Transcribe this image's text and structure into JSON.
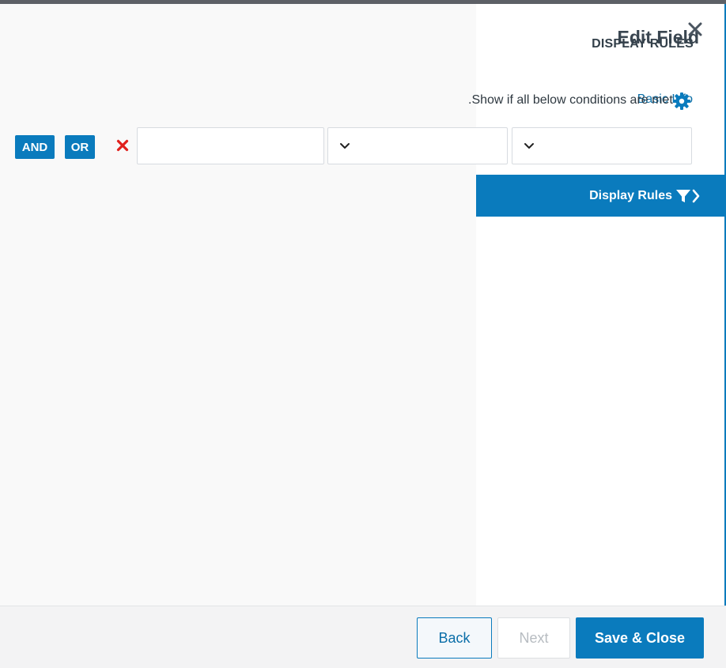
{
  "header": {
    "title": "Edit Field",
    "section_caption": "DISPLAY RULES",
    "basic_info_link": "Basic Info"
  },
  "rules": {
    "description": ".Show if all below conditions are met",
    "and_label": "AND",
    "or_label": "OR",
    "condition_row": {
      "text_value": "",
      "select_1_value": "",
      "select_2_value": ""
    }
  },
  "tabs": {
    "display_rules_label": "Display Rules"
  },
  "footer": {
    "back_label": "Back",
    "next_label": "Next",
    "save_close_label": "Save & Close"
  },
  "colors": {
    "primary": "#0a7bbd",
    "remove_red": "#e0201c",
    "left_panel_bg": "#f9f9f9",
    "footer_bg": "#f3f3f4"
  },
  "icons": {
    "close": "close-icon",
    "gear": "gear-icon",
    "remove": "remove-x-icon",
    "chevron": "chevron-down-icon",
    "filter": "filter-icon",
    "chevron_right": "chevron-right-icon"
  }
}
